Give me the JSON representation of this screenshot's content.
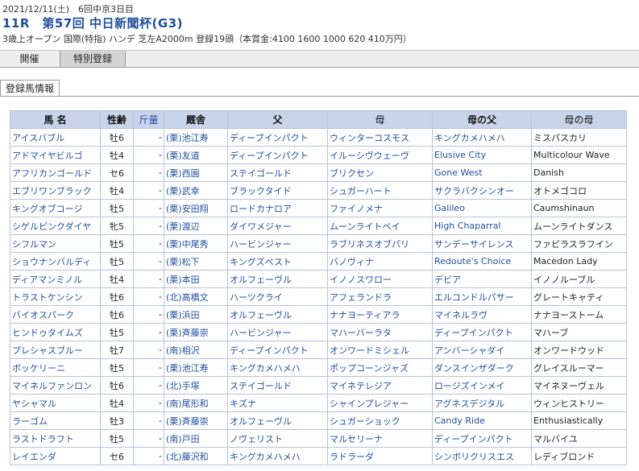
{
  "race": {
    "date_line": "2021/12/11(土)　6回中京3日目",
    "title": "11R　第57回 中日新聞杯(G3)",
    "conditions": "3歳上オープン 国際(特指) ハンデ 芝左A2000m 登録19頭（本賞金:4100 1600 1000 620 410万円）"
  },
  "tabs": [
    {
      "label": "開催"
    },
    {
      "label": "特別登録"
    }
  ],
  "subtab": {
    "label": "登録馬情報"
  },
  "table": {
    "headers": {
      "horse": "馬 名",
      "sex_age": "性齢",
      "weight": "斤量",
      "stable": "厩舎",
      "sire": "父",
      "dam": "母",
      "dam_sire": "母の父",
      "dam_dam": "母の母"
    },
    "rows": [
      {
        "horse": "アイスバブル",
        "sex_age": "牡6",
        "weight": "-",
        "stable": "(栗)池江寿",
        "sire": "ディープインパクト",
        "dam": "ウィンターコスモス",
        "dam_sire": "キングカメハメハ",
        "dam_dam": "ミスパスカリ"
      },
      {
        "horse": "アドマイヤビルゴ",
        "sex_age": "牡4",
        "weight": "-",
        "stable": "(栗)友道",
        "sire": "ディープインパクト",
        "dam": "イルーシヴウェーヴ",
        "dam_sire": "Elusive City",
        "dam_dam": "Multicolour Wave"
      },
      {
        "horse": "アフリカンゴールド",
        "sex_age": "セ6",
        "weight": "-",
        "stable": "(栗)西園",
        "sire": "ステイゴールド",
        "dam": "ブリクセン",
        "dam_sire": "Gone West",
        "dam_dam": "Danish"
      },
      {
        "horse": "エブリワンブラック",
        "sex_age": "牡4",
        "weight": "-",
        "stable": "(栗)武幸",
        "sire": "ブラックタイド",
        "dam": "シュガーハート",
        "dam_sire": "サクラバクシンオー",
        "dam_dam": "オトメゴコロ"
      },
      {
        "horse": "キングオブコージ",
        "sex_age": "牡5",
        "weight": "-",
        "stable": "(栗)安田翔",
        "sire": "ロードカナロア",
        "dam": "ファイノメナ",
        "dam_sire": "Galileo",
        "dam_dam": "Caumshinaun"
      },
      {
        "horse": "シゲルピンクダイヤ",
        "sex_age": "牝5",
        "weight": "-",
        "stable": "(栗)渡辺",
        "sire": "ダイワメジャー",
        "dam": "ムーンライトベイ",
        "dam_sire": "High Chaparral",
        "dam_dam": "ムーンライトダンス"
      },
      {
        "horse": "シフルマン",
        "sex_age": "牡5",
        "weight": "-",
        "stable": "(栗)中尾秀",
        "sire": "ハービンジャー",
        "dam": "ラブリネスオブパリ",
        "dam_sire": "サンデーサイレンス",
        "dam_dam": "ファビラスラフイン"
      },
      {
        "horse": "ショウナンバルディ",
        "sex_age": "牡5",
        "weight": "-",
        "stable": "(栗)松下",
        "sire": "キングズベスト",
        "dam": "バノヴィナ",
        "dam_sire": "Redoute's Choice",
        "dam_dam": "Macedon Lady"
      },
      {
        "horse": "ディアマンミノル",
        "sex_age": "牡4",
        "weight": "-",
        "stable": "(栗)本田",
        "sire": "オルフェーヴル",
        "dam": "イノノスワロー",
        "dam_sire": "デビア",
        "dam_dam": "イノノルーブル"
      },
      {
        "horse": "トラストケンシン",
        "sex_age": "牡6",
        "weight": "-",
        "stable": "(北)高橋文",
        "sire": "ハーツクライ",
        "dam": "アフェランドラ",
        "dam_sire": "エルコンドルパサー",
        "dam_dam": "グレートキャティ"
      },
      {
        "horse": "バイオスパーク",
        "sex_age": "牡6",
        "weight": "-",
        "stable": "(栗)浜田",
        "sire": "オルフェーヴル",
        "dam": "ナナヨーティアラ",
        "dam_sire": "マイネルラヴ",
        "dam_dam": "ナナヨーストーム"
      },
      {
        "horse": "ヒンドゥタイムズ",
        "sex_age": "牡5",
        "weight": "-",
        "stable": "(栗)斉藤崇",
        "sire": "ハービンジャー",
        "dam": "マハーバーラタ",
        "dam_sire": "ディープインパクト",
        "dam_dam": "マハーブ"
      },
      {
        "horse": "プレシャスブルー",
        "sex_age": "牡7",
        "weight": "-",
        "stable": "(南)相沢",
        "sire": "ディープインパクト",
        "dam": "オンワードミシェル",
        "dam_sire": "アンバーシャダイ",
        "dam_dam": "オンワードウッド"
      },
      {
        "horse": "ボッケリーニ",
        "sex_age": "牡5",
        "weight": "-",
        "stable": "(栗)池江寿",
        "sire": "キングカメハメハ",
        "dam": "ポップコーンジャズ",
        "dam_sire": "ダンスインザダーク",
        "dam_dam": "グレイスルーマー"
      },
      {
        "horse": "マイネルファンロン",
        "sex_age": "牡6",
        "weight": "-",
        "stable": "(北)手塚",
        "sire": "ステイゴールド",
        "dam": "マイネテレジア",
        "dam_sire": "ロージズインメイ",
        "dam_dam": "マイネヌーヴェル"
      },
      {
        "horse": "ヤシャマル",
        "sex_age": "牡4",
        "weight": "-",
        "stable": "(南)尾形和",
        "sire": "キズナ",
        "dam": "シャインプレジャー",
        "dam_sire": "アグネスデジタル",
        "dam_dam": "ウィンヒストリー"
      },
      {
        "horse": "ラーゴム",
        "sex_age": "牡3",
        "weight": "-",
        "stable": "(栗)斉藤崇",
        "sire": "オルフェーヴル",
        "dam": "シュガーショック",
        "dam_sire": "Candy Ride",
        "dam_dam": "Enthusiastically"
      },
      {
        "horse": "ラストドラフト",
        "sex_age": "牡5",
        "weight": "-",
        "stable": "(南)戸田",
        "sire": "ノヴェリスト",
        "dam": "マルセリーナ",
        "dam_sire": "ディープインパクト",
        "dam_dam": "マルバイユ"
      },
      {
        "horse": "レイエンダ",
        "sex_age": "セ6",
        "weight": "-",
        "stable": "(北)藤沢和",
        "sire": "キングカメハメハ",
        "dam": "ラドラーダ",
        "dam_sire": "シンボリクリスエス",
        "dam_dam": "レディブロンド"
      }
    ]
  },
  "colors": {
    "link": "#1f4e9c",
    "header_bg": "#c8d4ea",
    "border": "#b9c3d6"
  }
}
